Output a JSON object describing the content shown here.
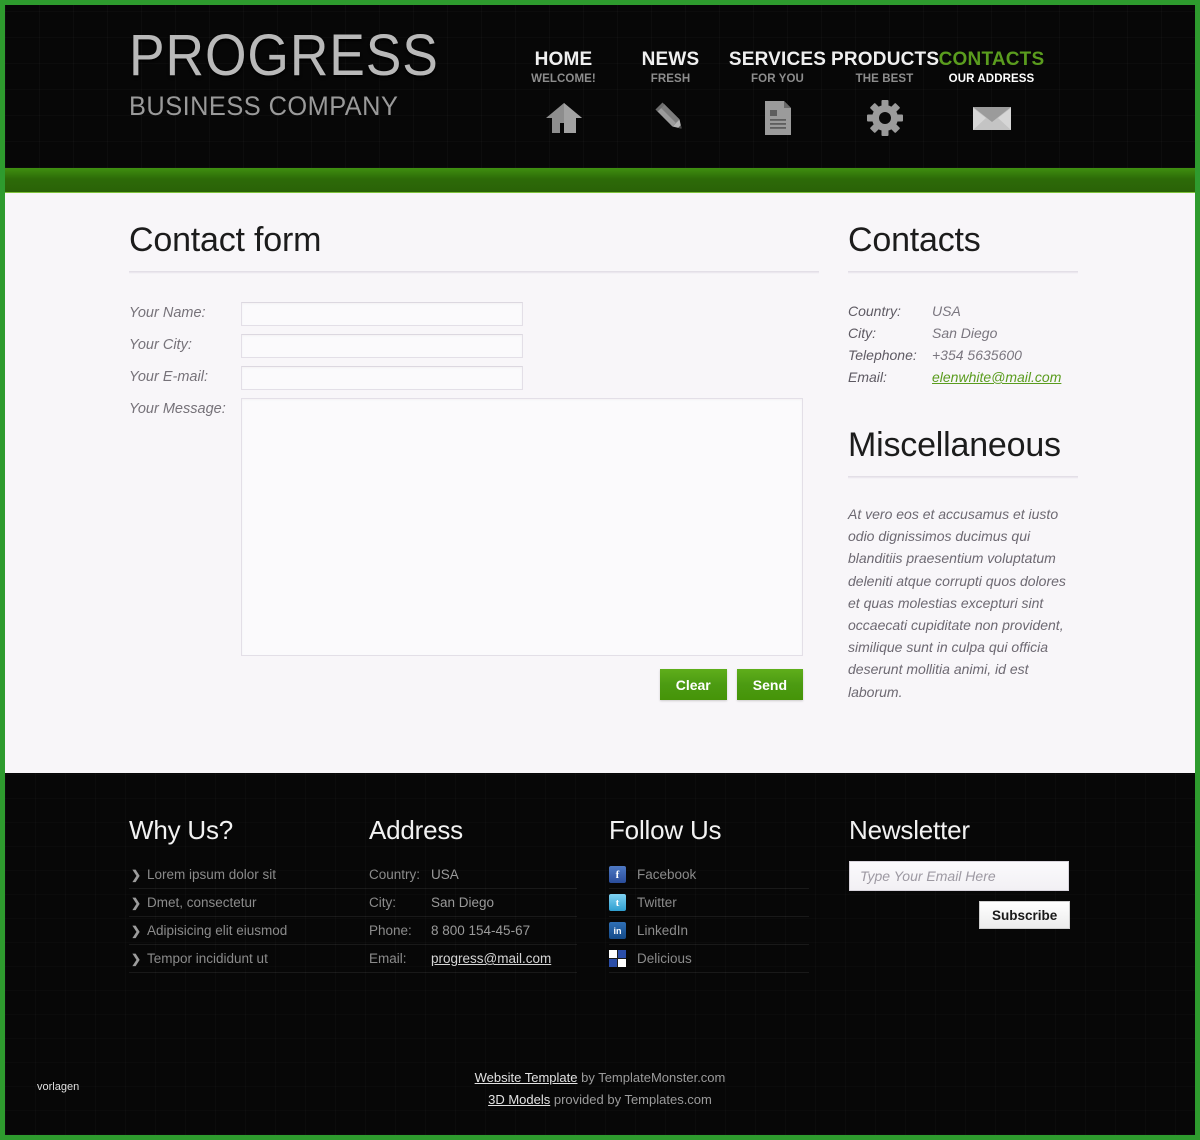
{
  "theme": {
    "accent_green": "#5a9c1e",
    "border_green": "#2e9b2e",
    "button_green": "#4c9b12",
    "content_bg": "#f8f6f9",
    "dark_bg": "#070707"
  },
  "header": {
    "logo_main": "PROGRESS",
    "logo_sub": "BUSINESS COMPANY",
    "nav": [
      {
        "title": "HOME",
        "sub": "WELCOME!",
        "icon": "home-icon",
        "active": false
      },
      {
        "title": "NEWS",
        "sub": "FRESH",
        "icon": "pencil-icon",
        "active": false
      },
      {
        "title": "SERVICES",
        "sub": "FOR YOU",
        "icon": "document-icon",
        "active": false
      },
      {
        "title": "PRODUCTS",
        "sub": "THE BEST",
        "icon": "gear-icon",
        "active": false
      },
      {
        "title": "CONTACTS",
        "sub": "OUR ADDRESS",
        "icon": "envelope-icon",
        "active": true
      }
    ]
  },
  "main": {
    "form": {
      "title": "Contact form",
      "fields": [
        {
          "label": "Your Name:",
          "value": "",
          "placeholder": ""
        },
        {
          "label": "Your City:",
          "value": "",
          "placeholder": ""
        },
        {
          "label": "Your E-mail:",
          "value": "",
          "placeholder": ""
        }
      ],
      "message_label": "Your Message:",
      "message_value": "",
      "clear_label": "Clear",
      "send_label": "Send"
    },
    "contacts": {
      "title": "Contacts",
      "rows": [
        {
          "key": "Country:",
          "value": "USA",
          "is_link": false
        },
        {
          "key": "City:",
          "value": "San Diego",
          "is_link": false
        },
        {
          "key": "Telephone:",
          "value": "+354 5635600",
          "is_link": false
        },
        {
          "key": "Email:",
          "value": "elenwhite@mail.com",
          "is_link": true
        }
      ]
    },
    "miscellaneous": {
      "title": "Miscellaneous",
      "text": "At vero eos et accusamus et iusto odio dignissimos ducimus qui blanditiis praesentium voluptatum deleniti atque corrupti quos dolores et quas molestias excepturi sint occaecati cupiditate non provident, similique sunt in culpa qui officia deserunt mollitia animi, id est laborum."
    }
  },
  "footer": {
    "why_us": {
      "title": "Why Us?",
      "items": [
        "Lorem ipsum dolor sit",
        "Dmet, consectetur",
        "Adipisicing elit eiusmod",
        "Tempor incididunt ut"
      ]
    },
    "address": {
      "title": "Address",
      "rows": [
        {
          "key": "Country:",
          "value": "USA",
          "is_link": false
        },
        {
          "key": "City:",
          "value": "San Diego",
          "is_link": false
        },
        {
          "key": "Phone:",
          "value": "8 800 154-45-67",
          "is_link": false
        },
        {
          "key": "Email:",
          "value": "progress@mail.com",
          "is_link": true
        }
      ]
    },
    "follow_us": {
      "title": "Follow Us",
      "items": [
        {
          "label": "Facebook",
          "icon": "facebook-icon",
          "glyph": "f"
        },
        {
          "label": "Twitter",
          "icon": "twitter-icon",
          "glyph": "t"
        },
        {
          "label": "LinkedIn",
          "icon": "linkedin-icon",
          "glyph": "in"
        },
        {
          "label": "Delicious",
          "icon": "delicious-icon",
          "glyph": ""
        }
      ]
    },
    "newsletter": {
      "title": "Newsletter",
      "input_value": "",
      "input_placeholder": "Type Your Email Here",
      "subscribe_label": "Subscribe"
    },
    "credits": {
      "line1_link": "Website Template",
      "line1_text": " by TemplateMonster.com",
      "line2_link": "3D Models",
      "line2_text": " provided by Templates.com"
    },
    "watermark": "vorlagen"
  }
}
